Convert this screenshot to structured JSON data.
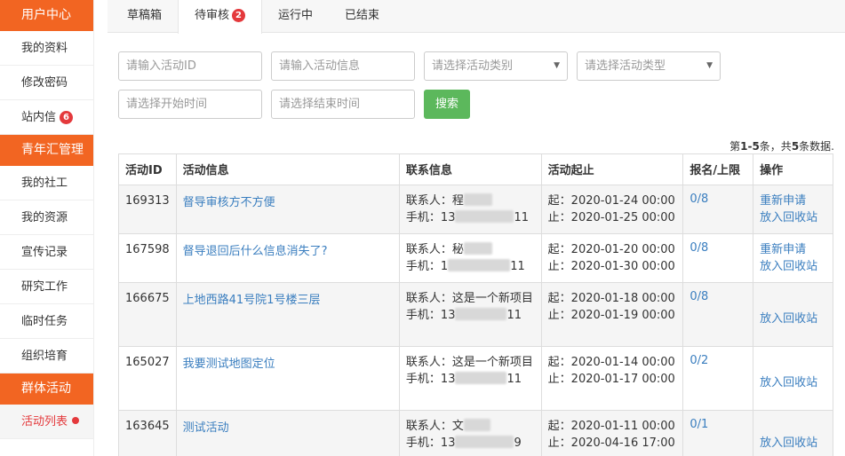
{
  "sidebar": {
    "sections": [
      {
        "header": "用户中心",
        "items": [
          {
            "label": "我的资料"
          },
          {
            "label": "修改密码"
          },
          {
            "label": "站内信",
            "badge": "6"
          }
        ]
      },
      {
        "header": "青年汇管理",
        "items": [
          {
            "label": "我的社工"
          },
          {
            "label": "我的资源"
          },
          {
            "label": "宣传记录"
          },
          {
            "label": "研究工作"
          },
          {
            "label": "临时任务"
          },
          {
            "label": "组织培育"
          }
        ]
      },
      {
        "header": "群体活动",
        "items": [
          {
            "label": "活动列表",
            "active": true
          }
        ]
      }
    ]
  },
  "tabs": [
    {
      "label": "草稿箱"
    },
    {
      "label": "待审核",
      "badge": "2",
      "active": true
    },
    {
      "label": "运行中"
    },
    {
      "label": "已结束"
    }
  ],
  "filters": {
    "activity_id_placeholder": "请输入活动ID",
    "activity_info_placeholder": "请输入活动信息",
    "category_placeholder": "请选择活动类别",
    "type_placeholder": "请选择活动类型",
    "start_time_placeholder": "请选择开始时间",
    "end_time_placeholder": "请选择结束时间",
    "search_label": "搜索"
  },
  "summary": {
    "prefix": "第",
    "range": "1-5",
    "mid": "条，共",
    "total": "5",
    "suffix": "条数据."
  },
  "table": {
    "headers": [
      "活动ID",
      "活动信息",
      "联系信息",
      "活动起止",
      "报名/上限",
      "操作"
    ],
    "rows": [
      {
        "id": "169313",
        "title": "督导审核方不方便",
        "contact": "联系人：程",
        "phone_prefix": "手机：13",
        "phone_suffix": "11",
        "start": "起：2020-01-24 00:00",
        "end": "止：2020-01-25 00:00",
        "quota": "0/8",
        "ops": [
          "重新申请",
          "放入回收站"
        ]
      },
      {
        "id": "167598",
        "title": "督导退回后什么信息消失了?",
        "contact": "联系人：秘",
        "phone_prefix": "手机：1",
        "phone_suffix": "11",
        "start": "起：2020-01-20 00:00",
        "end": "止：2020-01-30 00:00",
        "quota": "0/8",
        "ops": [
          "重新申请",
          "放入回收站"
        ]
      },
      {
        "id": "166675",
        "title": "上地西路41号院1号楼三层",
        "contact": "联系人：这是一个新项目",
        "phone_prefix": "手机：13",
        "phone_suffix": "11",
        "start": "起：2020-01-18 00:00",
        "end": "止：2020-01-19 00:00",
        "quota": "0/8",
        "ops": [
          "放入回收站"
        ]
      },
      {
        "id": "165027",
        "title": "我要测试地图定位",
        "contact": "联系人：这是一个新项目",
        "phone_prefix": "手机：13",
        "phone_suffix": "11",
        "start": "起：2020-01-14 00:00",
        "end": "止：2020-01-17 00:00",
        "quota": "0/2",
        "ops": [
          "放入回收站"
        ]
      },
      {
        "id": "163645",
        "title": "测试活动",
        "contact": "联系人：文",
        "phone_prefix": "手机：13",
        "phone_suffix": "9",
        "start": "起：2020-01-11 00:00",
        "end": "止：2020-04-16 17:00",
        "quota": "0/1",
        "ops": [
          "放入回收站"
        ]
      }
    ]
  },
  "colors": {
    "accent": "#f26522",
    "badge": "#e4393c",
    "link": "#3a7ebf",
    "search_button": "#5cb85c"
  }
}
